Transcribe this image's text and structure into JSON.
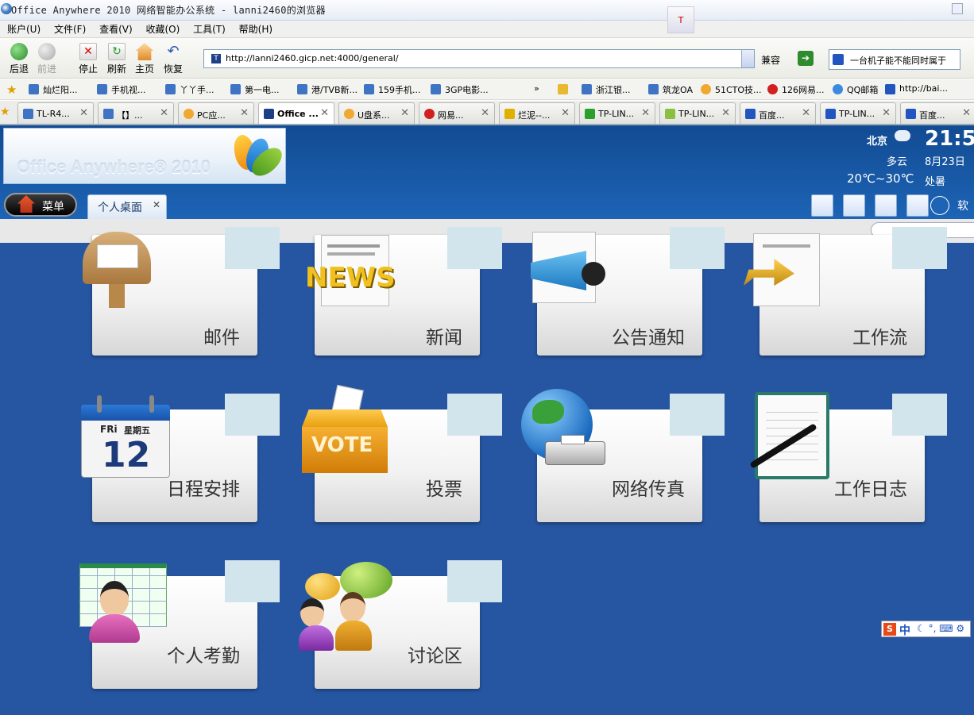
{
  "window": {
    "title": "Office Anywhere 2010 网络智能办公系统 - lanni2460的浏览器",
    "tray_icon": "trident"
  },
  "menu": [
    "账户(U)",
    "文件(F)",
    "查看(V)",
    "收藏(O)",
    "工具(T)",
    "帮助(H)"
  ],
  "toolbar": {
    "back": "后退",
    "forward": "前进",
    "stop": "停止",
    "refresh": "刷新",
    "home": "主页",
    "restore": "恢复",
    "address": "http://lanni2460.gicp.net:4000/general/",
    "compat": "兼容",
    "search_text": "一台机子能不能同时属于"
  },
  "favorites": [
    "灿烂阳...",
    "手机视...",
    "丫丫手...",
    "第一电...",
    "港/TVB新...",
    "159手机...",
    "3GP电影...",
    "»",
    "浙江银...",
    "筑龙OA",
    "51CTO技...",
    "126网易...",
    "QQ邮箱",
    "http://bai..."
  ],
  "tabs": [
    {
      "label": "TL-R4...",
      "active": false
    },
    {
      "label": "【】...",
      "active": false
    },
    {
      "label": "PC应...",
      "active": false
    },
    {
      "label": "Office ...",
      "active": true
    },
    {
      "label": "U盘系...",
      "active": false
    },
    {
      "label": "网易...",
      "active": false
    },
    {
      "label": "烂泥--...",
      "active": false
    },
    {
      "label": "TP-LIN...",
      "active": false
    },
    {
      "label": "TP-LIN...",
      "active": false
    },
    {
      "label": "百度...",
      "active": false
    },
    {
      "label": "TP-LIN...",
      "active": false
    },
    {
      "label": "百度...",
      "active": false
    }
  ],
  "app": {
    "logo_text": "Office Anywhere® 2010",
    "weather": {
      "city": "北京",
      "condition": "多云",
      "temp": "20℃~30℃",
      "time": "21:5",
      "date": "8月23日",
      "solar_term": "处暑"
    },
    "menu_button": "菜单",
    "desktop_tab": "个人桌面",
    "software_label": "软"
  },
  "tiles": [
    {
      "label": "邮件",
      "icon": "mailbox-icon"
    },
    {
      "label": "新闻",
      "icon": "news-icon"
    },
    {
      "label": "公告通知",
      "icon": "megaphone-icon"
    },
    {
      "label": "工作流",
      "icon": "workflow-icon"
    },
    {
      "label": "日程安排",
      "icon": "calendar-icon",
      "cal_day": "FRi",
      "cal_weekday": "星期五",
      "cal_date": "12"
    },
    {
      "label": "投票",
      "icon": "vote-box-icon",
      "box_text": "VOTE"
    },
    {
      "label": "网络传真",
      "icon": "fax-globe-icon"
    },
    {
      "label": "工作日志",
      "icon": "journal-icon"
    },
    {
      "label": "个人考勤",
      "icon": "attendance-icon"
    },
    {
      "label": "讨论区",
      "icon": "discussion-icon"
    }
  ],
  "ime": {
    "brand": "S",
    "mode": "中"
  }
}
